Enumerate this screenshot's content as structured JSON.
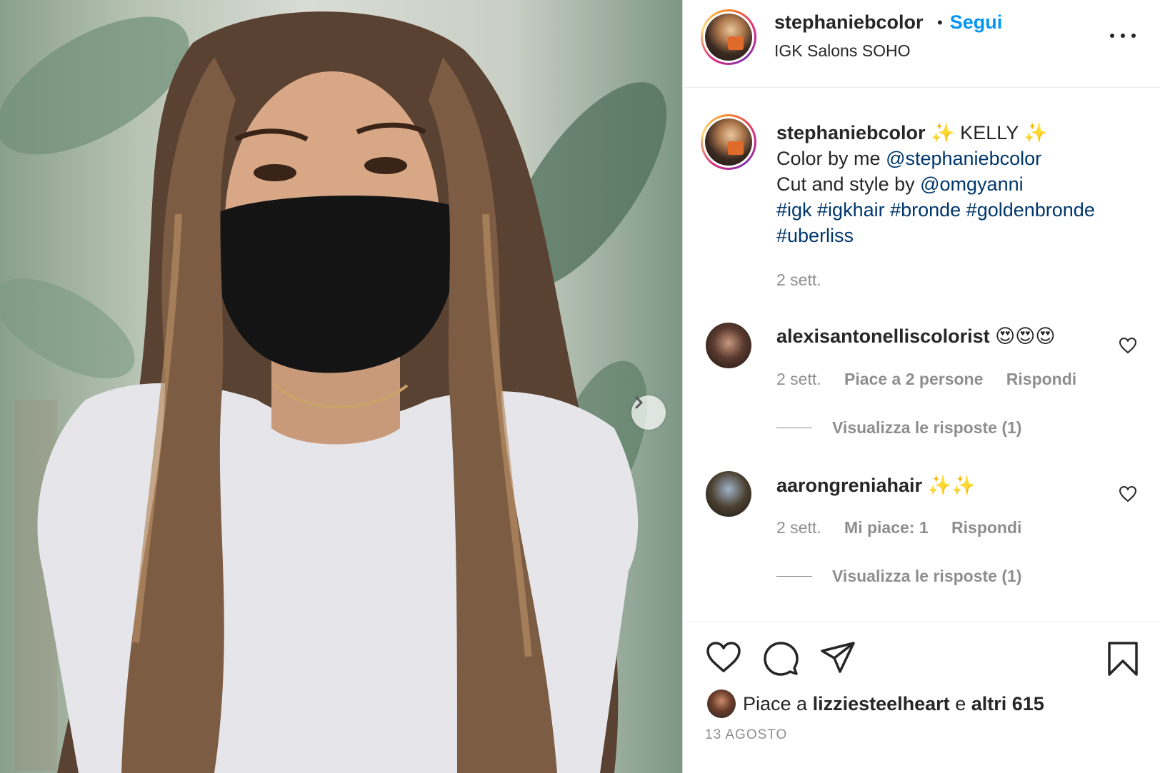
{
  "post": {
    "username": "stephaniebcolor",
    "follow_label": "Segui",
    "separator": "•",
    "location": "IGK Salons SOHO"
  },
  "caption": {
    "username": "stephaniebcolor",
    "title": "✨ KELLY ✨",
    "line2_prefix": "Color by me",
    "line2_mention": "@stephaniebcolor",
    "line3_prefix": "Cut and style by",
    "line3_mention": "@omgyanni",
    "hashtags_line1": "#igk #igkhair #bronde #goldenbronde",
    "hashtags_line2": "#uberliss",
    "age": "2 sett."
  },
  "comments": [
    {
      "username": "alexisantonelliscolorist",
      "text": "😍😍😍",
      "age": "2 sett.",
      "likes": "Piace a 2 persone",
      "reply": "Rispondi",
      "view_replies": "Visualizza le risposte (1)"
    },
    {
      "username": "aarongreniahair",
      "text": "✨✨",
      "age": "2 sett.",
      "likes": "Mi piace: 1",
      "reply": "Rispondi",
      "view_replies": "Visualizza le risposte (1)"
    }
  ],
  "likes": {
    "prefix": "Piace a",
    "user": "lizziesteelheart",
    "connector": "e",
    "others": "altri 615"
  },
  "date": "13 AGOSTO",
  "icons": {
    "more": "more-options-icon",
    "next": "chevron-right-icon",
    "like": "heart-icon",
    "comment": "comment-icon",
    "share": "paper-plane-icon",
    "save": "bookmark-icon"
  },
  "colors": {
    "follow": "#0095f6",
    "link": "#00376b",
    "muted": "#8e8e8e",
    "text": "#262626"
  }
}
